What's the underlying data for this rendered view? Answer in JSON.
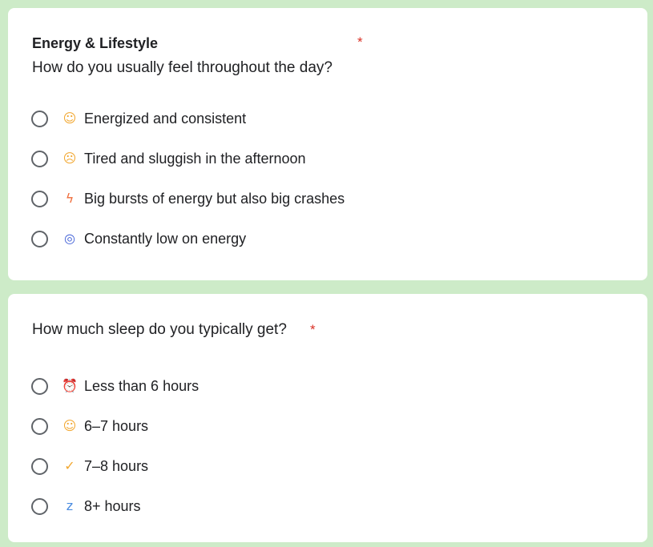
{
  "colors": {
    "background": "#cdebc8",
    "card": "#ffffff",
    "required": "#d93025",
    "radio_border": "#5f6368"
  },
  "section1": {
    "title": "Energy & Lifestyle",
    "required_mark": "*",
    "question": "How do you usually feel throughout the day?",
    "options": [
      {
        "icon": "smiling-face-icon",
        "glyph": "☺",
        "color": "#f2a72f",
        "label": "Energized and consistent"
      },
      {
        "icon": "sleepy-face-icon",
        "glyph": "☹",
        "color": "#f2a72f",
        "label": "Tired and sluggish in the afternoon"
      },
      {
        "icon": "lightning-icon",
        "glyph": "ϟ",
        "color": "#ef6c3a",
        "label": "Big bursts of energy but also big crashes"
      },
      {
        "icon": "spiral-icon",
        "glyph": "◎",
        "color": "#3f5fd6",
        "label": "Constantly low on energy"
      }
    ]
  },
  "section2": {
    "question": "How much sleep do you typically get?",
    "required_mark": "*",
    "options": [
      {
        "icon": "alarm-clock-icon",
        "glyph": "⏰",
        "color": "#e0463a",
        "label": "Less than 6 hours"
      },
      {
        "icon": "neutral-face-icon",
        "glyph": "☺",
        "color": "#f2a72f",
        "label": "6–7 hours"
      },
      {
        "icon": "thumbs-up-icon",
        "glyph": "✓",
        "color": "#f2a72f",
        "label": "7–8 hours"
      },
      {
        "icon": "zzz-icon",
        "glyph": "z",
        "color": "#4a8be0",
        "label": "8+ hours"
      }
    ]
  }
}
